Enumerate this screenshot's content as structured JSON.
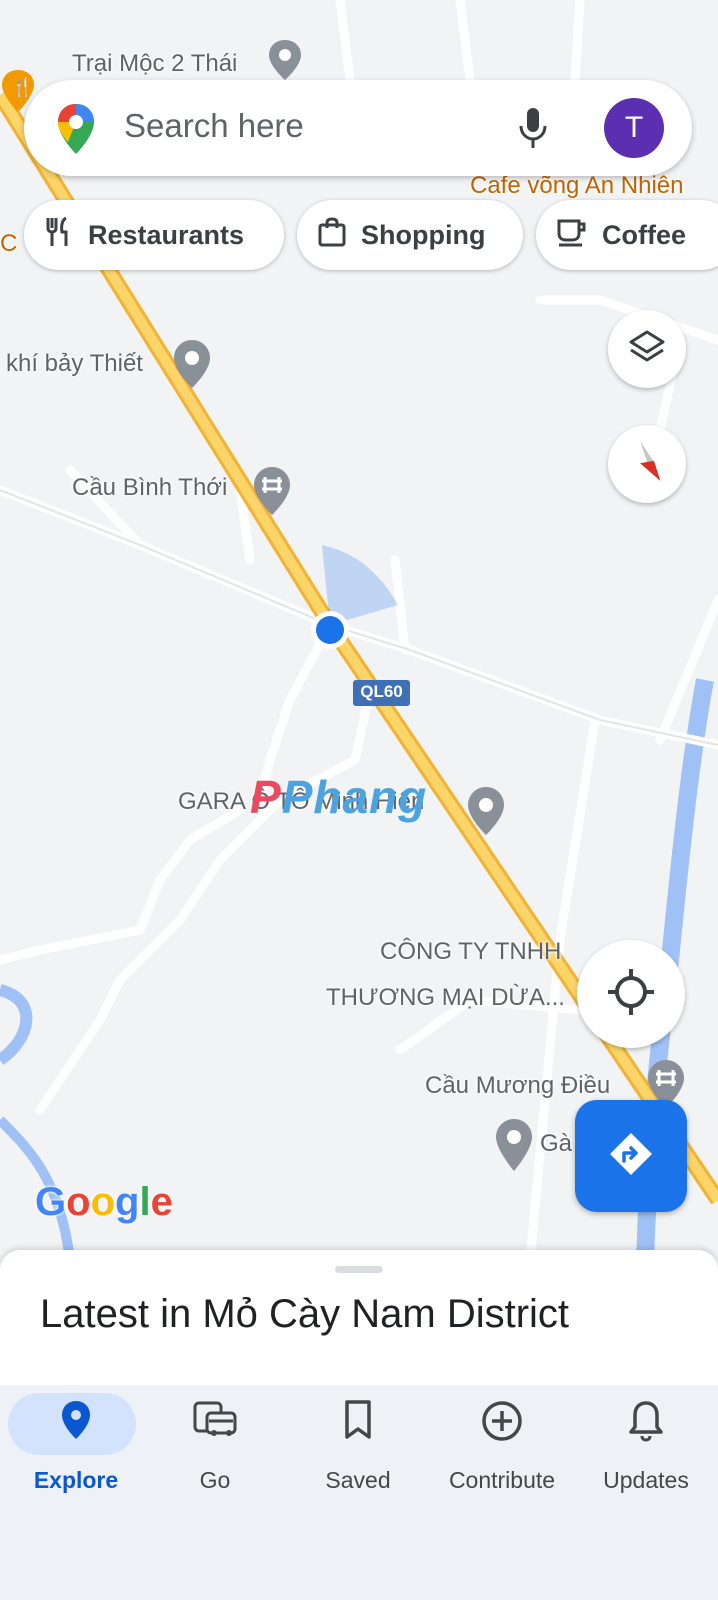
{
  "search": {
    "placeholder": "Search here",
    "avatar_letter": "T"
  },
  "chips": [
    {
      "label": "Restaurants",
      "icon": "restaurant-icon"
    },
    {
      "label": "Shopping",
      "icon": "shopping-bag-icon"
    },
    {
      "label": "Coffee",
      "icon": "coffee-cup-icon"
    }
  ],
  "map_labels": {
    "trai_moc": "Trại Mộc 2 Thái",
    "cafe": "Cafe võng An Nhiên",
    "co_khi": "khí bảy Thiết",
    "cau_binh_thoi": "Cầu Bình Thới",
    "road_shield": "QL60",
    "gara": "GARA Ô TÔ Minh Hiển",
    "cong_ty_1": "CÔNG TY TNHH",
    "cong_ty_2": "THƯƠNG MẠI DỪA...",
    "cau_muong_dieu": "Cầu Mương Điều",
    "ga": "Gà",
    "google": "Google",
    "watermark": "Phang",
    "left_c": "C"
  },
  "sheet": {
    "title": "Latest in Mỏ Cày Nam District"
  },
  "nav": [
    {
      "label": "Explore",
      "active": true
    },
    {
      "label": "Go",
      "active": false
    },
    {
      "label": "Saved",
      "active": false
    },
    {
      "label": "Contribute",
      "active": false
    },
    {
      "label": "Updates",
      "active": false
    }
  ],
  "colors": {
    "accent": "#1a73e8",
    "highway": "#f6c443",
    "water": "#9fc1f5",
    "avatar": "#5b2fb0"
  }
}
